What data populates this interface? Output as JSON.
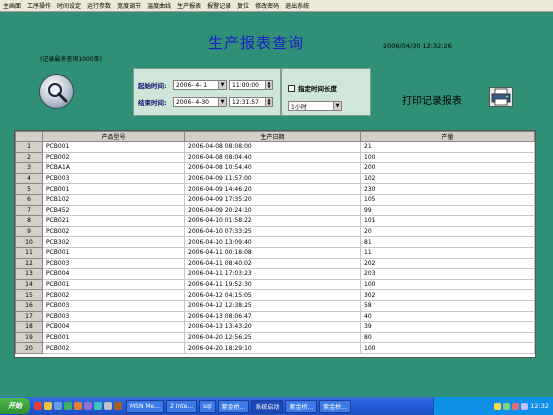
{
  "menu": [
    "主画面",
    "工序操作",
    "时间设定",
    "运行参数",
    "宽度调节",
    "温度曲线",
    "生产报表",
    "报警记录",
    "复位",
    "修改密码",
    "退出系统"
  ],
  "page": {
    "title": "生产报表查询",
    "datetime": "2006/04/30   12:32:26",
    "max_note": "(记录最多查询1000条)",
    "print_label": "打印记录报表"
  },
  "query": {
    "start_label": "起始时间:",
    "start_date": "2006- 4- 1",
    "start_time": "11:00:00",
    "end_label": "结束时间:",
    "end_date": "2006- 4-30",
    "end_time": "12:31:57",
    "fixed_interval_label": "指定时间长度",
    "interval_value": "1小时"
  },
  "table": {
    "headers": [
      "",
      "产品型号",
      "生产日期",
      "产量"
    ],
    "rows": [
      [
        "1",
        "PCB001",
        "2006-04-08 08:08:00",
        "21"
      ],
      [
        "2",
        "PCB002",
        "2006-04-08 08:04:40",
        "100"
      ],
      [
        "3",
        "PCBA1A",
        "2006-04-08 10:54:40",
        "200"
      ],
      [
        "4",
        "PCB003",
        "2006-04-09 11:57:00",
        "102"
      ],
      [
        "5",
        "PCB001",
        "2006-04-09 14:46:20",
        "230"
      ],
      [
        "6",
        "PCB102",
        "2006-04-09 17:35:20",
        "105"
      ],
      [
        "7",
        "PCB452",
        "2006-04-09 20:24:10",
        "99"
      ],
      [
        "8",
        "PCB021",
        "2006-04-10 01:58:22",
        "101"
      ],
      [
        "9",
        "PCB002",
        "2006-04-10 07:33:25",
        "20"
      ],
      [
        "10",
        "PCB302",
        "2006-04-10 13:09:40",
        "81"
      ],
      [
        "11",
        "PCB001",
        "2006-04-11 00:18:08",
        "11"
      ],
      [
        "12",
        "PCB003",
        "2006-04-11 08:40:02",
        "202"
      ],
      [
        "13",
        "PCB004",
        "2006-04-11 17:03:23",
        "203"
      ],
      [
        "14",
        "PCB001",
        "2006-04-11 19:52:30",
        "100"
      ],
      [
        "15",
        "PCB002",
        "2006-04-12 04:15:05",
        "302"
      ],
      [
        "16",
        "PCB003",
        "2006-04-12 12:38:25",
        "58"
      ],
      [
        "17",
        "PCB003",
        "2006-04-13 08:06:47",
        "40"
      ],
      [
        "18",
        "PCB004",
        "2006-04-13 13:43:20",
        "39"
      ],
      [
        "19",
        "PCB001",
        "2006-04-20 12:56:25",
        "80"
      ],
      [
        "20",
        "PCB002",
        "2006-04-20 18:29:10",
        "100"
      ]
    ]
  },
  "taskbar": {
    "start": "开始",
    "tasks": [
      "MSN Me...",
      "2 Inte...",
      "sql",
      "紫金桥...",
      "系统启动",
      "紫金桥...",
      "紫金桥..."
    ],
    "active_index": 4,
    "clock": "12:32"
  }
}
